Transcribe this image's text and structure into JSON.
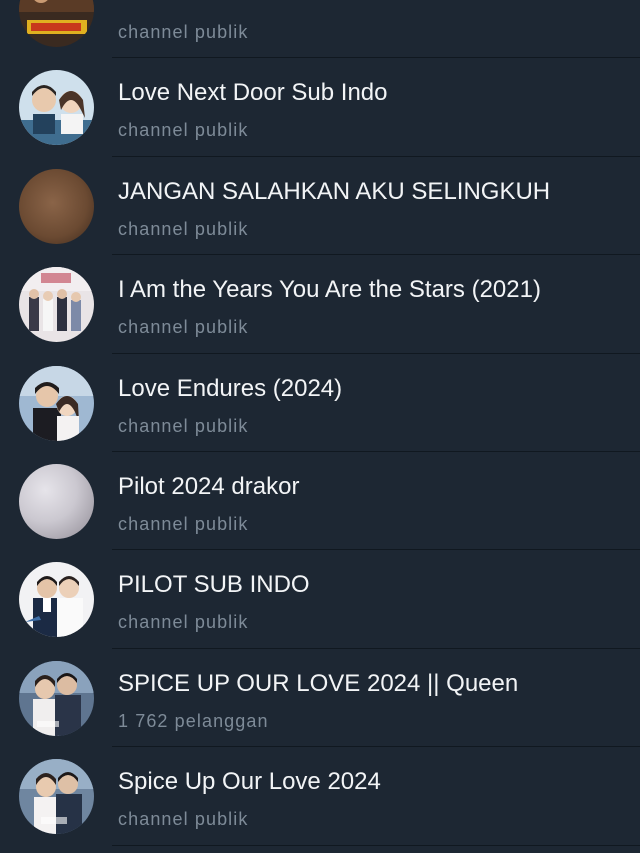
{
  "channels": [
    {
      "title": "",
      "subtitle": "channel publik",
      "avatar": "poster-avatar"
    },
    {
      "title": "Love Next Door Sub Indo",
      "subtitle": "channel publik",
      "avatar": "couple-photo-avatar"
    },
    {
      "title": "JANGAN SALAHKAN AKU SELINGKUH",
      "subtitle": "channel publik",
      "avatar": "blurred-brown-avatar"
    },
    {
      "title": "I Am the Years You Are the Stars (2021)",
      "subtitle": "channel publik",
      "avatar": "group-poster-avatar"
    },
    {
      "title": "Love Endures (2024)",
      "subtitle": "channel publik",
      "avatar": "couple-poster-avatar"
    },
    {
      "title": "Pilot 2024 drakor",
      "subtitle": "channel publik",
      "avatar": "blurred-grey-avatar"
    },
    {
      "title": "PILOT SUB INDO",
      "subtitle": "channel publik",
      "avatar": "pilot-poster-avatar"
    },
    {
      "title": "SPICE UP OUR LOVE 2024 || Queen",
      "subtitle": "1 762 pelanggan",
      "avatar": "drama-poster-avatar"
    },
    {
      "title": "Spice Up Our Love 2024",
      "subtitle": "channel publik",
      "avatar": "drama-poster-avatar"
    }
  ],
  "colors": {
    "background": "#1d2733",
    "title": "#f2f4f6",
    "subtitle": "#7e8b98",
    "divider": "#101820"
  }
}
